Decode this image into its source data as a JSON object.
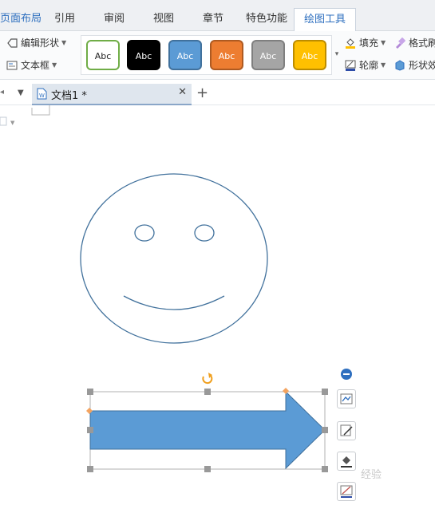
{
  "title_strip": {
    "text": ""
  },
  "tabs": [
    {
      "label": "页面布局"
    },
    {
      "label": "引用"
    },
    {
      "label": "审阅"
    },
    {
      "label": "视图"
    },
    {
      "label": "章节"
    },
    {
      "label": "特色功能"
    },
    {
      "label": "绘图工具"
    }
  ],
  "ribbon": {
    "edit_shape": "编辑形状",
    "text_box": "文本框",
    "fill": "填充",
    "outline": "轮廓",
    "format_painter": "格式刷",
    "shape_effect": "形状效果"
  },
  "styles": [
    {
      "label": "Abc",
      "bg": "#ffffff",
      "border": "#70ad47",
      "color": "#222222"
    },
    {
      "label": "Abc",
      "bg": "#000000",
      "border": "#000000",
      "color": "#ffffff"
    },
    {
      "label": "Abc",
      "bg": "#5b9bd5",
      "border": "#41719c",
      "color": "#ffffff"
    },
    {
      "label": "Abc",
      "bg": "#ed7d31",
      "border": "#ae5a21",
      "color": "#ffffff"
    },
    {
      "label": "Abc",
      "bg": "#a5a5a5",
      "border": "#7f7f7f",
      "color": "#ffffff"
    },
    {
      "label": "Abc",
      "bg": "#ffc000",
      "border": "#bc8c00",
      "color": "#ffffff"
    }
  ],
  "document": {
    "tab_title": "文档1 *"
  },
  "colors": {
    "accent": "#2e6fbf",
    "smiley_stroke": "#41719c",
    "arrow_fill": "#5b9bd5",
    "handle": "#999999",
    "handle_orange": "#f4a460",
    "rotate": "#f0a020"
  },
  "watermark": "经验"
}
